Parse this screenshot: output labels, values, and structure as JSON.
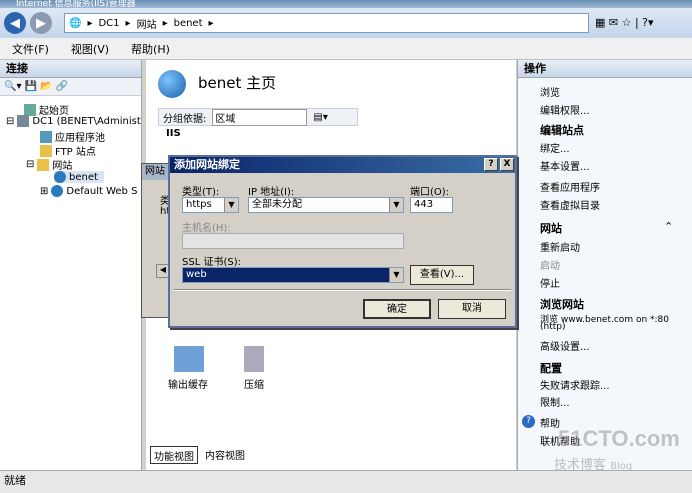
{
  "window": {
    "title": "Internet 信息服务(IIS)管理器"
  },
  "address": {
    "segments": [
      "DC1",
      "网站",
      "benet"
    ]
  },
  "menu": [
    "文件(F)",
    "视图(V)",
    "帮助(H)"
  ],
  "connections": {
    "header": "连接",
    "tree": [
      "起始页",
      "DC1 (BENET\\Administ",
      "应用程序池",
      "FTP 站点",
      "网站",
      "benet",
      "Default Web S"
    ]
  },
  "center": {
    "title": "benet 主页",
    "group_label": "分组依据:",
    "group_value": "区域",
    "section": "IIS",
    "icons": [
      "输出缓存",
      "压缩"
    ],
    "tabs": [
      "功能视图",
      "内容视图"
    ],
    "bg_dialog_title": "网站",
    "bg_col": "类",
    "bg_cell": "ht"
  },
  "actions": {
    "header": "操作",
    "items": [
      "浏览",
      "编辑权限...",
      "编辑站点",
      "绑定...",
      "基本设置...",
      "查看应用程序",
      "查看虚拟目录",
      "网站",
      "重新启动",
      "启动",
      "停止",
      "浏览网站",
      "浏览 www.benet.com on *:80",
      "(http)",
      "高级设置...",
      "配置",
      "失败请求跟踪...",
      "限制...",
      "帮助",
      "联机帮助"
    ]
  },
  "dialog": {
    "title": "添加网站绑定",
    "type_label": "类型(T):",
    "type_value": "https",
    "ip_label": "IP 地址(I):",
    "ip_value": "全部未分配",
    "port_label": "端口(O):",
    "port_value": "443",
    "host_label": "主机名(H):",
    "host_value": "",
    "ssl_label": "SSL 证书(S):",
    "ssl_value": "web",
    "view_button": "查看(V)...",
    "ok_button": "确定",
    "cancel_button": "取消",
    "help": "?",
    "close": "X"
  },
  "status": {
    "text": "就绪"
  },
  "watermark": {
    "line1": "51CTO.com",
    "line2": "技术博客",
    "line3": "Blog"
  }
}
